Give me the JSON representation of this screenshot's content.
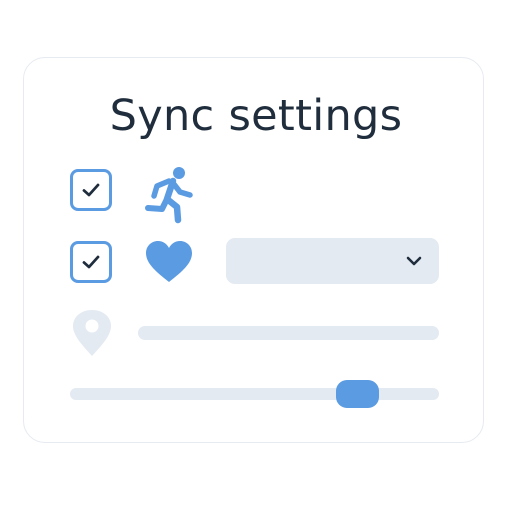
{
  "title": "Sync settings",
  "colors": {
    "accent": "#5b9be2",
    "track": "#e3eaf2",
    "text": "#1f2d3d",
    "disabled_icon": "#e3eaf2"
  },
  "rows": [
    {
      "checkbox_checked": true,
      "icon": "running-person-icon"
    },
    {
      "checkbox_checked": true,
      "icon": "heart-icon",
      "dropdown_value": ""
    },
    {
      "icon": "location-pin-icon"
    }
  ],
  "slider": {
    "value_fraction": 0.78
  }
}
